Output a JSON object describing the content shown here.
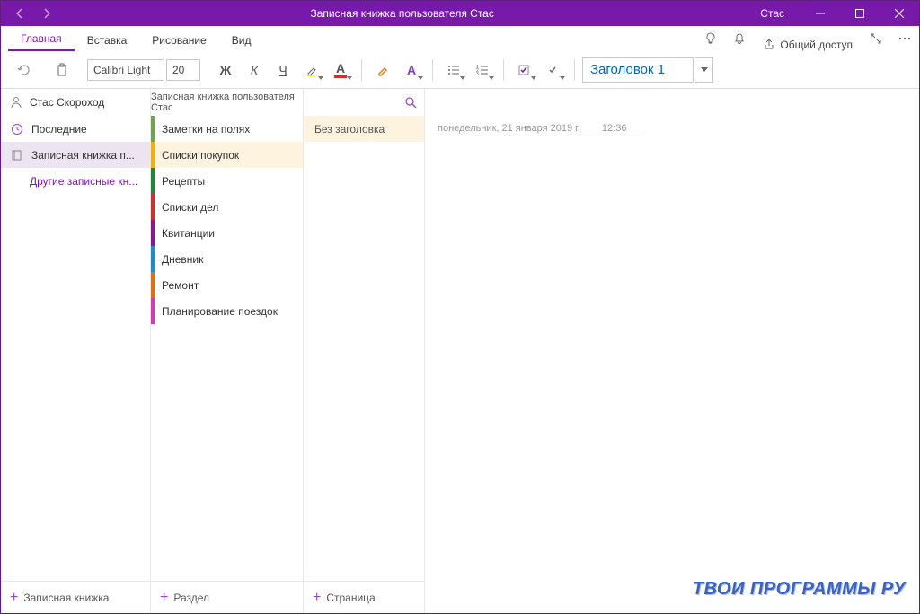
{
  "titlebar": {
    "title": "Записная книжка пользователя Стас",
    "user": "Стас"
  },
  "tabs": {
    "main": "Главная",
    "insert": "Вставка",
    "draw": "Рисование",
    "view": "Вид",
    "share": "Общий доступ"
  },
  "ribbon": {
    "font_name": "Calibri Light",
    "font_size": "20",
    "bold": "Ж",
    "italic": "К",
    "underline": "Ч",
    "heading": "Заголовок 1"
  },
  "nav": {
    "user": "Стас Скороход",
    "recent": "Последние",
    "notebook": "Записная книжка п...",
    "other": "Другие записные кн...",
    "add_notebook": "Записная книжка"
  },
  "sections": {
    "header": "Записная книжка пользователя Стас",
    "items": [
      {
        "label": "Заметки на полях",
        "color": "#6fa34f"
      },
      {
        "label": "Списки покупок",
        "color": "#f0b400"
      },
      {
        "label": "Рецепты",
        "color": "#1a8a3a"
      },
      {
        "label": "Списки дел",
        "color": "#d62c2c"
      },
      {
        "label": "Квитанции",
        "color": "#8d178d"
      },
      {
        "label": "Дневник",
        "color": "#1a8ec9"
      },
      {
        "label": "Ремонт",
        "color": "#e86b0c"
      },
      {
        "label": "Планирование поездок",
        "color": "#d63ab0"
      }
    ],
    "add_section": "Раздел"
  },
  "pages": {
    "items": [
      {
        "label": "Без заголовка"
      }
    ],
    "add_page": "Страница"
  },
  "content": {
    "date": "понедельник, 21 января 2019 г.",
    "time": "12:36"
  },
  "watermark": "ТВОИ ПРОГРАММЫ РУ"
}
